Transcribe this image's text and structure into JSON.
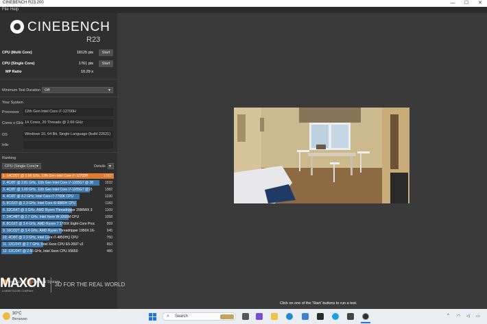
{
  "window": {
    "title": "CINEBENCH R23.200",
    "minimize": "—",
    "maximize": "☐",
    "close": "✕"
  },
  "menu": {
    "file": "File",
    "help": "Help"
  },
  "logo": {
    "name": "CINEBENCH",
    "version": "R23"
  },
  "scores": {
    "multi": {
      "label": "CPU (Multi Core)",
      "value": "18125 pts",
      "button": "Start"
    },
    "single": {
      "label": "CPU (Single Core)",
      "value": "1761 pts",
      "button": "Start"
    },
    "ratio": {
      "label": "MP Ratio",
      "value": "10.29 x"
    }
  },
  "min_duration": {
    "label": "Minimum Test Duration",
    "value": "Off"
  },
  "system": {
    "heading": "Your System",
    "processor_label": "Processor",
    "processor": "12th Gen Intel Core i7-12700H",
    "cores_label": "Cores x GHz",
    "cores": "14 Cores, 20 Threads @ 2.69 GHz",
    "os_label": "OS",
    "os": "Windows 10, 64 Bit, Single Language (build 22621)",
    "info_label": "Info",
    "info": ""
  },
  "ranking": {
    "heading": "Ranking",
    "filter": "CPU (Single Core)",
    "details": "Details",
    "rows": [
      {
        "text": "1. 14C/20T @ 2.69 GHz, 12th Gen Intel Core i7-12700H",
        "score": "1761*",
        "fill": 1.0,
        "active": true
      },
      {
        "text": "2. 4C/8T @ 2.81 GHz, 11th Gen Intel Core i7-1165G7 @ 28",
        "score": "1532",
        "fill": 0.87,
        "active": false
      },
      {
        "text": "3. 4C/8T @ 1.69 GHz, 11th Gen Intel Core i7-1165G7 @15",
        "score": "1382",
        "fill": 0.785,
        "active": false
      },
      {
        "text": "4. 4C/8T @ 4.2 GHz, Intel Core i7-7700K CPU",
        "score": "1230",
        "fill": 0.698,
        "active": false
      },
      {
        "text": "5. 8C/16T @ 2.3 GHz, Intel Core i9-9880H CPU",
        "score": "1183",
        "fill": 0.672,
        "active": false
      },
      {
        "text": "6. 32C/64T @ 3 GHz, AMD Ryzen Threadripper 2990WX 3",
        "score": "1109",
        "fill": 0.63,
        "active": false
      },
      {
        "text": "7. 24C/48T @ 2.7 GHz, Intel Xeon W-3265M CPU",
        "score": "1058",
        "fill": 0.6,
        "active": false
      },
      {
        "text": "8. 8C/16T @ 3.4 GHz, AMD Ryzen 7 1700X Eight-Core Proc",
        "score": "959",
        "fill": 0.545,
        "active": false
      },
      {
        "text": "9. 16C/32T @ 3.4 GHz, AMD Ryzen Threadripper 1950X 16-",
        "score": "945",
        "fill": 0.537,
        "active": false
      },
      {
        "text": "10. 4C/8T @ 2.3 GHz, Intel Core i7-4850HQ CPU",
        "score": "750",
        "fill": 0.426,
        "active": false
      },
      {
        "text": "11. 12C/24T @ 2.7 GHz, Intel Xeon CPU E5-2697 v2",
        "score": "653",
        "fill": 0.371,
        "active": false
      },
      {
        "text": "12. 12C/24T @ 2.66 GHz, Intel Xeon CPU X5650",
        "score": "486",
        "fill": 0.276,
        "active": false
      }
    ]
  },
  "legend": {
    "your_score": "Your Score",
    "identical": "Identical System"
  },
  "brand": {
    "name": "MAXON",
    "sub": "A NEMETSCHEK COMPANY",
    "tagline": "3D FOR THE REAL WORLD"
  },
  "hint": "Click on one of the 'Start' buttons to run a test.",
  "taskbar": {
    "temp": "30°C",
    "weather": "Berawan",
    "search": "Search",
    "icons": [
      "file-explorer-icon",
      "mail-icon",
      "edge-icon",
      "store-icon",
      "photos-icon",
      "cortana-icon",
      "terminal-icon",
      "cinebench-icon"
    ]
  },
  "colors": {
    "accent": "#e07a2c",
    "bar": "#3b78b0",
    "identical": "#c8642a"
  }
}
